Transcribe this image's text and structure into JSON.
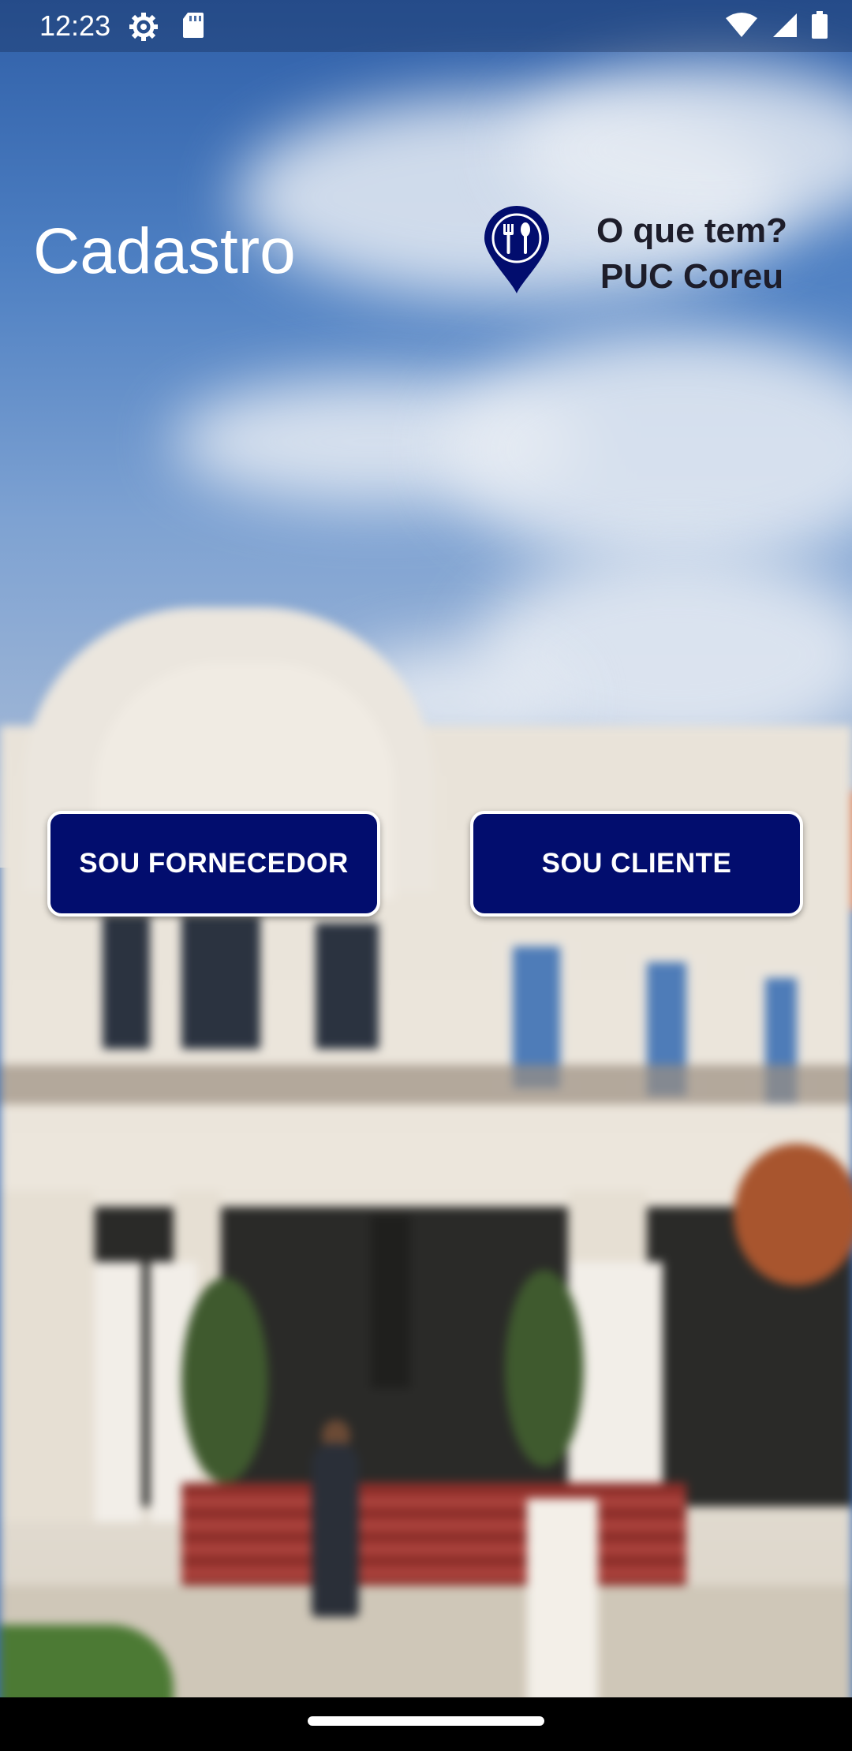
{
  "status_bar": {
    "time": "12:23",
    "left_icons": [
      "settings-icon",
      "sd-card-icon"
    ],
    "right_icons": [
      "wifi-icon",
      "signal-icon",
      "battery-icon"
    ]
  },
  "header": {
    "title": "Cadastro",
    "brand": {
      "icon": "map-pin-cutlery-icon",
      "line1": "O que tem?",
      "line2": "PUC Coreu"
    }
  },
  "actions": {
    "supplier_label": "SOU FORNECEDOR",
    "client_label": "SOU CLIENTE"
  },
  "colors": {
    "button_bg": "#020d6e",
    "button_border": "#ffffff",
    "pin_color": "#020d6e"
  }
}
